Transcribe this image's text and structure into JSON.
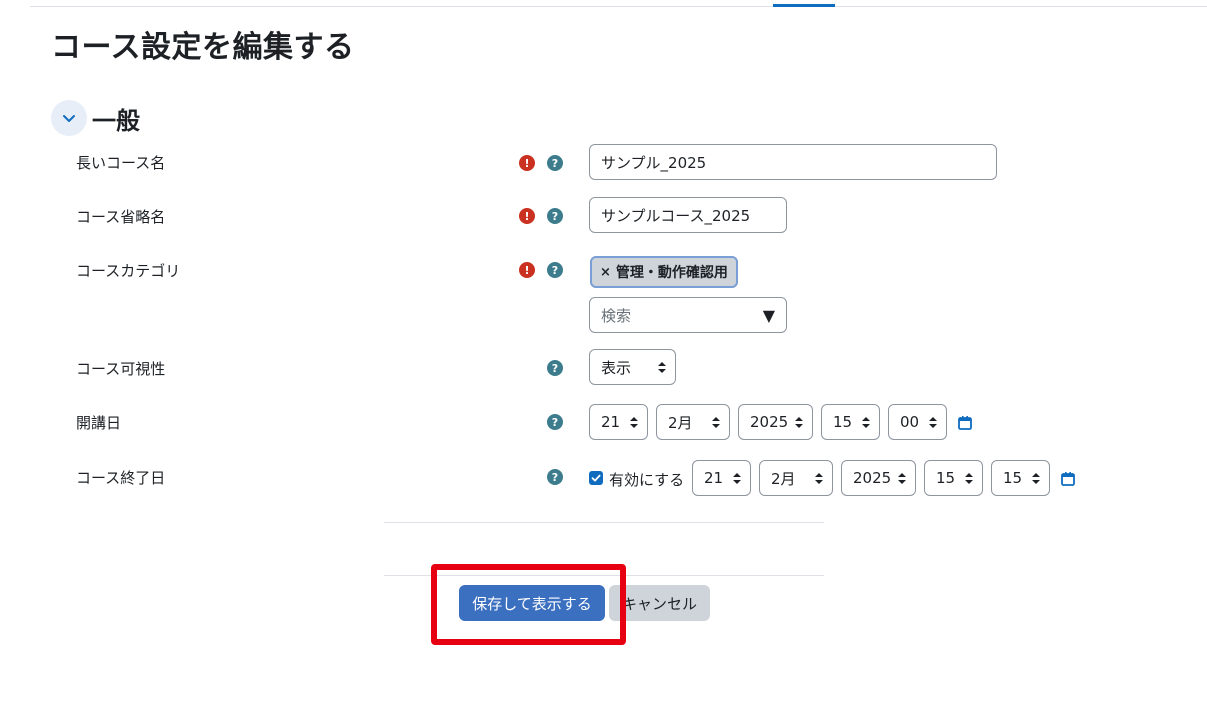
{
  "page": {
    "title": "コース設定を編集する"
  },
  "section": {
    "title": "一般"
  },
  "fields": {
    "fullname": {
      "label": "長いコース名",
      "value": "サンプル_2025"
    },
    "shortname": {
      "label": "コース省略名",
      "value": "サンプルコース_2025"
    },
    "category": {
      "label": "コースカテゴリ",
      "tag": "管理・動作確認用",
      "tag_remove": "×",
      "search_placeholder": "検索",
      "dropdown_arrow": "▼"
    },
    "visibility": {
      "label": "コース可視性",
      "value": "表示"
    },
    "startdate": {
      "label": "開講日",
      "day": "21",
      "month": "2月",
      "year": "2025",
      "hour": "15",
      "minute": "00"
    },
    "enddate": {
      "label": "コース終了日",
      "enable_label": "有効にする",
      "enabled": true,
      "day": "21",
      "month": "2月",
      "year": "2025",
      "hour": "15",
      "minute": "15"
    }
  },
  "icons": {
    "required": "!",
    "help": "?"
  },
  "buttons": {
    "save": "保存して表示する",
    "cancel": "キャンセル"
  },
  "colors": {
    "primary": "#3b6fc0",
    "required": "#ca3120",
    "help": "#3c7c8c",
    "highlight": "#e60012",
    "secondary": "#ced4da"
  }
}
